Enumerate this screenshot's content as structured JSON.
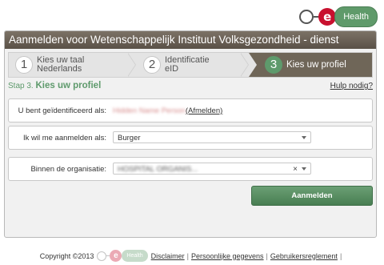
{
  "logo": {
    "e": "e",
    "pill": "Health"
  },
  "window": {
    "title": "Aanmelden voor Wetenschappelijk Instituut Volksgezondheid - dienst healthdata"
  },
  "steps": [
    {
      "num": "1",
      "label_line1": "Kies uw taal",
      "label_line2": "Nederlands"
    },
    {
      "num": "2",
      "label_line1": "Identificatie",
      "label_line2": "eID"
    },
    {
      "num": "3",
      "label_line1": "Kies uw profiel",
      "label_line2": ""
    }
  ],
  "subheader": {
    "prefix": "Stap 3.",
    "title": "Kies uw profiel",
    "help": "Hulp nodig?"
  },
  "identity": {
    "label": "U bent geïdentificeerd als:",
    "name": "Hidden Name Person",
    "logout": "(Afmelden)"
  },
  "profile": {
    "label": "Ik wil me aanmelden als:",
    "value": "Burger"
  },
  "organisation": {
    "label": "Binnen de organisatie:",
    "value": "HOSPITAL ORGANIS...",
    "clear": "×"
  },
  "submit": {
    "label": "Aanmelden"
  },
  "footer": {
    "copyright": "Copyright ©2013",
    "logo_pill": "Health",
    "links": [
      "Disclaimer",
      "Persoonlijke gegevens",
      "Gebruikersreglement"
    ]
  },
  "colors": {
    "accent": "#5f9a6a",
    "brand_red": "#c8102e",
    "header": "#6f6658"
  }
}
